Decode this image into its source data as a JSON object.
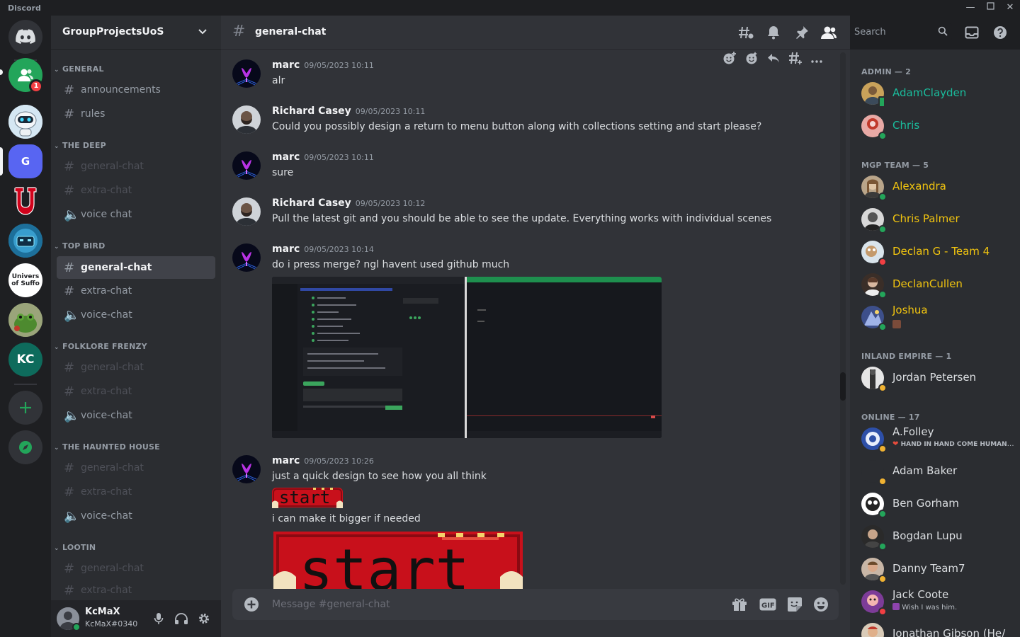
{
  "app": {
    "title": "Discord"
  },
  "servers": [
    {
      "name": "Direct Messages",
      "icon": "discord-logo-icon"
    },
    {
      "name": "Friends",
      "icon": "friends-icon",
      "badge": "1"
    },
    {
      "name": "Robot server",
      "icon": "robot-avatar"
    },
    {
      "name": "GroupProjectsUoS",
      "initial": "G"
    },
    {
      "name": "U server",
      "icon": "red-u-logo"
    },
    {
      "name": "Cyber server",
      "icon": "cyber-avatar"
    },
    {
      "name": "University of Suffolk",
      "abbrev_lines": [
        "Univers",
        "of Suffo"
      ]
    },
    {
      "name": "Frog server",
      "icon": "frog-avatar"
    },
    {
      "name": "KC server",
      "initial": "KC"
    }
  ],
  "rail_actions": {
    "add_server": "add-server",
    "explore": "explore"
  },
  "guild": {
    "name": "GroupProjectsUoS"
  },
  "categories": [
    {
      "name": "GENERAL",
      "channels": [
        {
          "name": "announcements",
          "type": "text",
          "state": "normal"
        },
        {
          "name": "rules",
          "type": "text",
          "state": "normal"
        }
      ]
    },
    {
      "name": "THE DEEP",
      "channels": [
        {
          "name": "general-chat",
          "type": "text",
          "state": "muted"
        },
        {
          "name": "extra-chat",
          "type": "text",
          "state": "muted"
        },
        {
          "name": "voice chat",
          "type": "voice",
          "state": "normal"
        }
      ]
    },
    {
      "name": "TOP BIRD",
      "channels": [
        {
          "name": "general-chat",
          "type": "text",
          "state": "active"
        },
        {
          "name": "extra-chat",
          "type": "text",
          "state": "normal"
        },
        {
          "name": "voice-chat",
          "type": "voice",
          "state": "normal"
        }
      ]
    },
    {
      "name": "FOLKLORE FRENZY",
      "channels": [
        {
          "name": "general-chat",
          "type": "text",
          "state": "muted"
        },
        {
          "name": "extra-chat",
          "type": "text",
          "state": "muted"
        },
        {
          "name": "voice-chat",
          "type": "voice",
          "state": "normal"
        }
      ]
    },
    {
      "name": "THE HAUNTED HOUSE",
      "channels": [
        {
          "name": "general-chat",
          "type": "text",
          "state": "muted"
        },
        {
          "name": "extra-chat",
          "type": "text",
          "state": "muted"
        },
        {
          "name": "voice-chat",
          "type": "voice",
          "state": "normal"
        }
      ]
    },
    {
      "name": "LOOTIN",
      "channels": [
        {
          "name": "general-chat",
          "type": "text",
          "state": "muted"
        },
        {
          "name": "extra-chat",
          "type": "text",
          "state": "muted"
        }
      ]
    }
  ],
  "user": {
    "name": "KcMaX",
    "tag": "KcMaX#0340"
  },
  "channel": {
    "name": "general-chat",
    "composer_placeholder": "Message #general-chat"
  },
  "search": {
    "placeholder": "Search"
  },
  "messages": [
    {
      "author": "marc",
      "timestamp": "09/05/2023 10:11",
      "text": "alr"
    },
    {
      "author": "Richard Casey",
      "timestamp": "09/05/2023 10:11",
      "text": "Could you possibly design a return to menu button along with collections setting and start please?"
    },
    {
      "author": "marc",
      "timestamp": "09/05/2023 10:11",
      "text": "sure"
    },
    {
      "author": "Richard Casey",
      "timestamp": "09/05/2023 10:12",
      "text": "Pull the latest git and you should be able to see the update. Everything works with individual scenes"
    },
    {
      "author": "marc",
      "timestamp": "09/05/2023 10:14",
      "text": "do i press merge? ngl havent used github much",
      "attachment": "screenshot"
    },
    {
      "author": "marc",
      "timestamp": "09/05/2023 10:26",
      "text": "just a quick design to see how you all think",
      "followup": "i can make it bigger if needed",
      "image_text": "start"
    }
  ],
  "members": {
    "groups": [
      {
        "label": "ADMIN — 2",
        "members": [
          {
            "name": "AdamClayden",
            "color": "#1abc9c",
            "status": "mobile"
          },
          {
            "name": "Chris",
            "color": "#1abc9c",
            "status": "online"
          }
        ]
      },
      {
        "label": "MGP TEAM — 5",
        "members": [
          {
            "name": "Alexandra",
            "color": "#f1c40f",
            "status": "online"
          },
          {
            "name": "Chris Palmer",
            "color": "#f1c40f",
            "status": "online"
          },
          {
            "name": "Declan G - Team 4",
            "color": "#f1c40f",
            "status": "dnd"
          },
          {
            "name": "DeclanCullen",
            "color": "#f1c40f",
            "status": "online"
          },
          {
            "name": "Joshua",
            "color": "#f1c40f",
            "status": "online",
            "activity_icon": "game-icon"
          }
        ]
      },
      {
        "label": "INLAND EMPIRE — 1",
        "members": [
          {
            "name": "Jordan Petersen",
            "color": "#dbdee1",
            "status": "idle"
          }
        ]
      },
      {
        "label": "ONLINE — 17",
        "members": [
          {
            "name": "A.Folley",
            "color": "#dbdee1",
            "status": "idle",
            "activity": "HAND IN HAND COME HUMAN ..."
          },
          {
            "name": "Adam Baker",
            "color": "#dbdee1",
            "status": "idle"
          },
          {
            "name": "Ben Gorham",
            "color": "#dbdee1",
            "status": "online"
          },
          {
            "name": "Bogdan Lupu",
            "color": "#dbdee1",
            "status": "online"
          },
          {
            "name": "Danny Team7",
            "color": "#dbdee1",
            "status": "idle"
          },
          {
            "name": "Jack Coote",
            "color": "#dbdee1",
            "status": "dnd",
            "activity": "Wish I was him."
          },
          {
            "name": "Jonathan Gibson (He/",
            "color": "#dbdee1",
            "status": "online"
          }
        ]
      }
    ]
  },
  "colors": {
    "online": "#23a55a",
    "idle": "#f0b232",
    "dnd": "#f23f43",
    "accent": "#5865f2"
  }
}
